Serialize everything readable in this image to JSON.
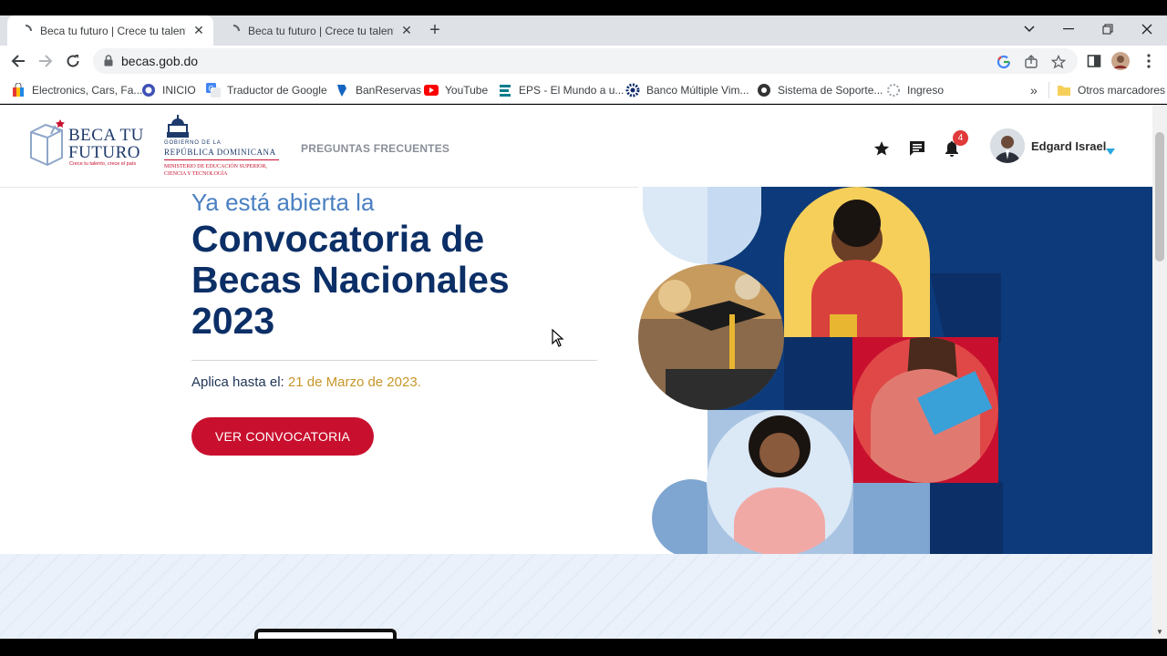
{
  "browser": {
    "tabs": [
      {
        "title": "Beca tu futuro | Crece tu talento,",
        "active": true
      },
      {
        "title": "Beca tu futuro | Crece tu talento,",
        "active": false
      }
    ],
    "address": "becas.gob.do",
    "bookmarks": [
      {
        "label": "Electronics, Cars, Fa...",
        "icon": "shopping-bag-icon"
      },
      {
        "label": "INICIO",
        "icon": "shield-icon"
      },
      {
        "label": "Traductor de Google",
        "icon": "translate-icon"
      },
      {
        "label": "BanReservas",
        "icon": "bank-icon"
      },
      {
        "label": "YouTube",
        "icon": "youtube-icon"
      },
      {
        "label": "EPS - El Mundo a u...",
        "icon": "eps-icon"
      },
      {
        "label": "Banco Múltiple Vim...",
        "icon": "gear-icon"
      },
      {
        "label": "Sistema de Soporte...",
        "icon": "support-icon"
      },
      {
        "label": "Ingreso",
        "icon": "loading-icon"
      }
    ],
    "other_bookmarks": "Otros marcadores",
    "more_bookmarks": "»"
  },
  "site": {
    "logo": {
      "line1": "BECA TU",
      "line2": "FUTURO",
      "tagline": "Crece tu talento, crece el país"
    },
    "gov_logo": {
      "line1": "GOBIERNO DE LA",
      "line2": "REPÚBLICA DOMINICANA",
      "line3": "MINISTERIO DE EDUCACIÓN SUPERIOR,",
      "line4": "CIENCIA Y TECNOLOGÍA"
    },
    "nav": {
      "faq": "PREGUNTAS FRECUENTES"
    },
    "notifications_count": "4",
    "user_name": "Edgard Israel"
  },
  "hero": {
    "kicker": "Ya está abierta la",
    "title": "Convocatoria de Becas Nacionales 2023",
    "deadline_label": "Aplica hasta el:",
    "deadline_date": "21 de Marzo de 2023.",
    "cta": "VER CONVOCATORIA"
  },
  "colors": {
    "navy": "#0b2f66",
    "blue_accent": "#4a7fc1",
    "cta_red": "#c8102e",
    "date_gold": "#c89628",
    "art_navy": "#0d3a7a"
  }
}
